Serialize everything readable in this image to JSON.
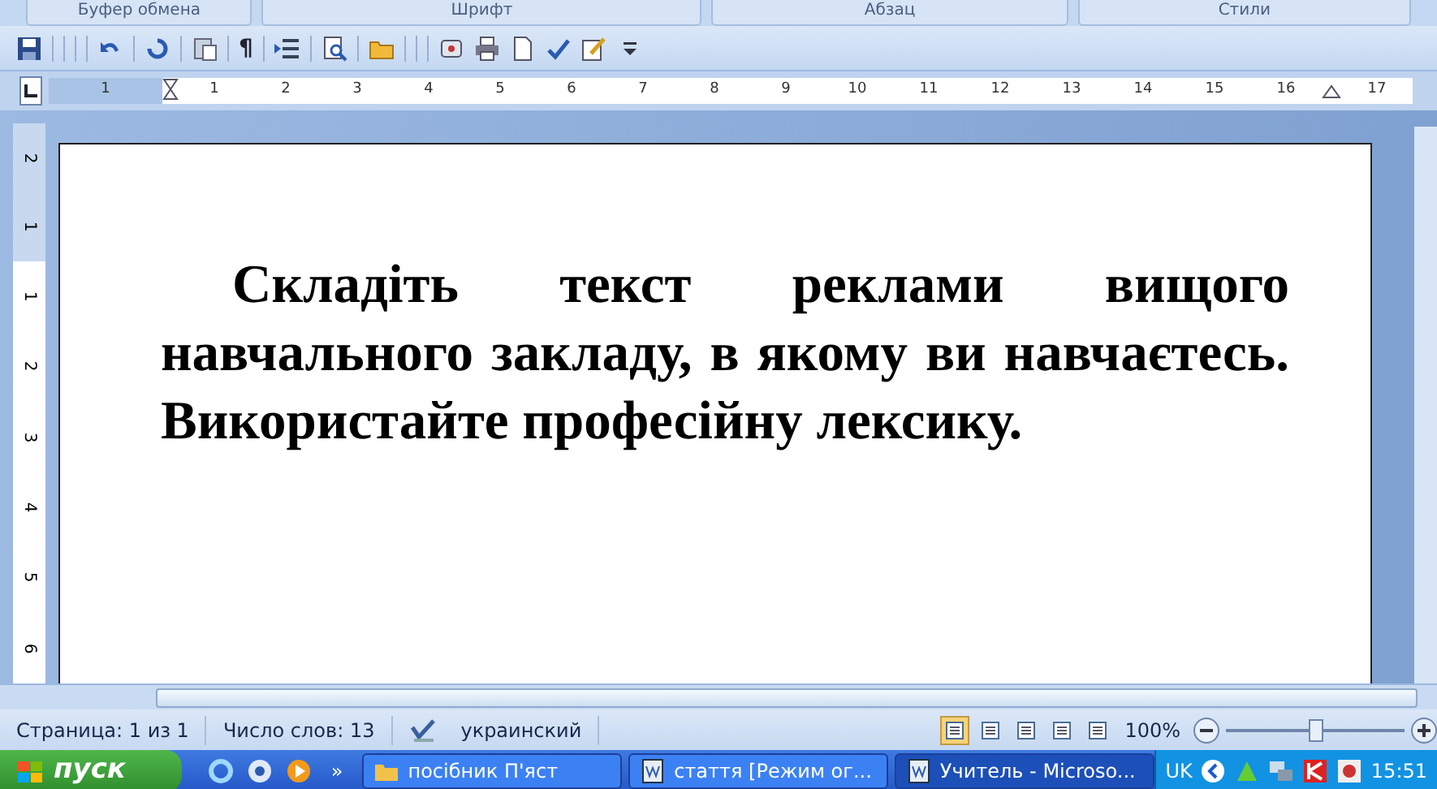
{
  "ribbon_groups": [
    "Буфер обмена",
    "Шрифт",
    "Абзац",
    "Стили"
  ],
  "toolbar": {
    "pilcrow": "¶"
  },
  "horizontal_ruler": {
    "left_marks": [
      "1"
    ],
    "marks": [
      "1",
      "2",
      "3",
      "4",
      "5",
      "6",
      "7",
      "8",
      "9",
      "10",
      "11",
      "12",
      "13",
      "14",
      "15",
      "16",
      "17"
    ]
  },
  "vertical_ruler": {
    "top_marks": [
      "2",
      "1"
    ],
    "marks": [
      "1",
      "2",
      "3",
      "4",
      "5",
      "6"
    ]
  },
  "document": {
    "paragraph": "Складіть текст реклами вищого навчального закладу, в якому ви навчаєтесь. Використайте професійну лексику."
  },
  "status_bar": {
    "page": "Страница: 1 из 1",
    "words": "Число слов: 13",
    "language": "украинский",
    "views": [
      {
        "selected": true
      },
      {
        "selected": false
      },
      {
        "selected": false
      },
      {
        "selected": false
      },
      {
        "selected": false
      }
    ],
    "zoom": "100%",
    "zoom_level": {
      "level": 0.5
    }
  },
  "taskbar": {
    "start": "пуск",
    "more": "»",
    "tasks": [
      {
        "kind": "folder",
        "label": "посібник П'яст",
        "selected": false
      },
      {
        "kind": "document",
        "label": "стаття [Режим ог...",
        "selected": false
      },
      {
        "kind": "document",
        "label": "Учитель - Microso...",
        "selected": true
      }
    ],
    "language": "UK",
    "clock": "15:51"
  }
}
